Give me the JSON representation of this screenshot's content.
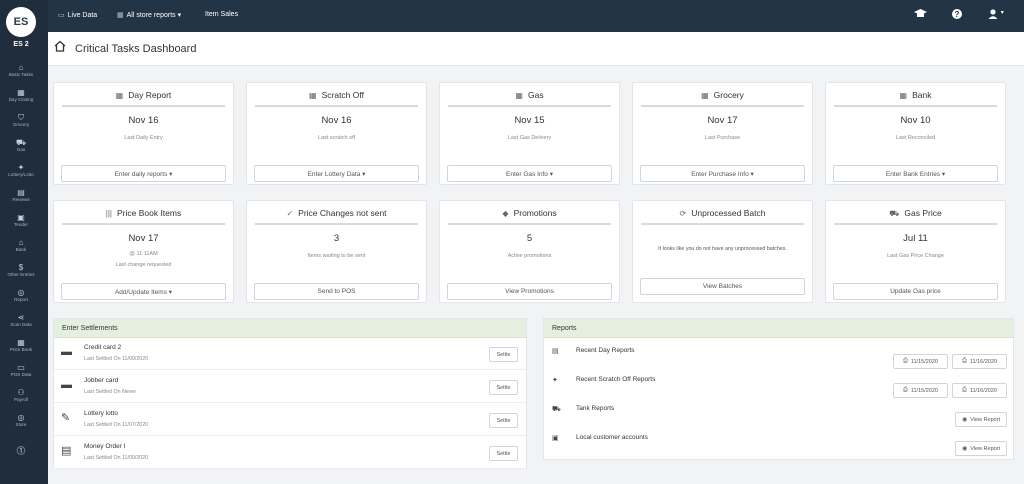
{
  "sidebar": {
    "avatar": "ES",
    "store_code": "ES 2",
    "items": [
      {
        "label": "Basic Tasks",
        "icon": "⌂"
      },
      {
        "label": "Day Closing",
        "icon": "▦"
      },
      {
        "label": "Grocery",
        "icon": "⛉"
      },
      {
        "label": "Gas",
        "icon": "⛟"
      },
      {
        "label": "Lottery/Lotto",
        "icon": "✦"
      },
      {
        "label": "Reviews",
        "icon": "▤"
      },
      {
        "label": "Tender",
        "icon": "▣"
      },
      {
        "label": "Bank",
        "icon": "⌂"
      },
      {
        "label": "Other Entries",
        "icon": "$"
      },
      {
        "label": "Report",
        "icon": "◎"
      },
      {
        "label": "Scan Data",
        "icon": "⋖"
      },
      {
        "label": "Price Book",
        "icon": "▦"
      },
      {
        "label": "POS Data",
        "icon": "▭"
      },
      {
        "label": "Payroll",
        "icon": "⚇"
      },
      {
        "label": "Store",
        "icon": "◎"
      }
    ],
    "bottom_icon": "⓵"
  },
  "topbar": {
    "live_data": "Live Data",
    "store_reports": "All store reports ▾",
    "item_sales": "Item Sales",
    "caret": "▾"
  },
  "page": {
    "title": "Critical Tasks Dashboard"
  },
  "cards_row1": [
    {
      "title": "Day Report",
      "icon": "▦",
      "value": "Nov  16",
      "sub": "Last Daily Entry",
      "button": "Enter daily reports ▾"
    },
    {
      "title": "Scratch Off",
      "icon": "▦",
      "value": "Nov  16",
      "sub": "Last scratch off",
      "button": "Enter Lottery Data ▾"
    },
    {
      "title": "Gas",
      "icon": "▦",
      "value": "Nov  15",
      "sub": "Last Gas Delivery",
      "button": "Enter Gas Info ▾"
    },
    {
      "title": "Grocery",
      "icon": "▦",
      "value": "Nov  17",
      "sub": "Last Purchase",
      "button": "Enter Purchase Info ▾"
    },
    {
      "title": "Bank",
      "icon": "▦",
      "value": "Nov  10",
      "sub": "Last Reconciled",
      "button": "Enter Bank Entries ▾"
    }
  ],
  "cards_row2": [
    {
      "title": "Price Book Items",
      "icon": "|||",
      "value": "Nov  17",
      "sub": "@ 11:11AM",
      "sub2": "Last change requested",
      "button": "Add/Update Items ▾"
    },
    {
      "title": "Price Changes not sent",
      "icon": "✓",
      "value": "3",
      "sub": "Items waiting to be sent",
      "button": "Send to POS"
    },
    {
      "title": "Promotions",
      "icon": "◆",
      "value": "5",
      "sub": "Active promotions",
      "button": "View Promotions"
    },
    {
      "title": "Unprocessed Batch",
      "icon": "⟳",
      "message": "It looks like you do not have any unprocessed batches.",
      "button": "View Batches"
    },
    {
      "title": "Gas Price",
      "icon": "⛟",
      "value": "Jul  11",
      "sub": "Last Gas Price Change",
      "button": "Update Gas price"
    }
  ],
  "settlements": {
    "title": "Enter Settlements",
    "rows": [
      {
        "name": "Credit card 2",
        "date": "Last Settled On 11/09/2020",
        "button": "Settle",
        "icon": "▬"
      },
      {
        "name": "Jobber card",
        "date": "Last Settled On Never",
        "button": "Settle",
        "icon": "▬"
      },
      {
        "name": "Lottery lotto",
        "date": "Last Settled On 11/07/2020",
        "button": "Settle",
        "icon": "✎"
      },
      {
        "name": "Money Order I",
        "date": "Last Settled On 11/09/2020",
        "button": "Settle",
        "icon": "▤"
      }
    ]
  },
  "reports": {
    "title": "Reports",
    "rows": [
      {
        "name": "Recent Day Reports",
        "icon": "▤",
        "buttons": [
          "11/15/2020",
          "11/16/2020"
        ]
      },
      {
        "name": "Recent Scratch Off Reports",
        "icon": "✦",
        "buttons": [
          "11/15/2020",
          "11/16/2020"
        ]
      },
      {
        "name": "Tank Reports",
        "icon": "⛟",
        "buttons": [
          "View Report"
        ]
      },
      {
        "name": "Local customer accounts",
        "icon": "▣",
        "buttons": [
          "View Report"
        ]
      }
    ],
    "print_icon": "⎙",
    "eye_icon": "◉"
  },
  "colors": {
    "sidebar_bg": "#1f2d3d",
    "topbar_bg": "#243447",
    "panel_head_bg": "#e4efdf"
  }
}
